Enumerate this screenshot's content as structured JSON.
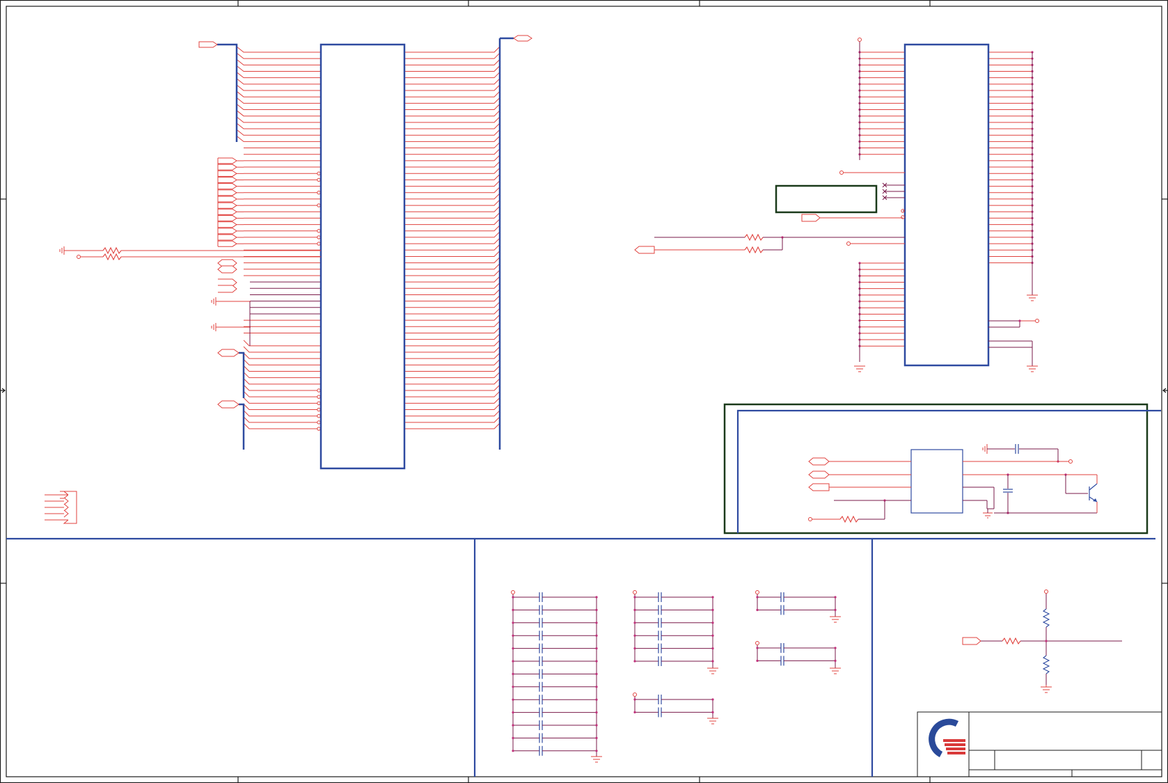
{
  "schematic": {
    "sheet_width": 1678,
    "sheet_height": 1125,
    "colors": {
      "wire": "#e0423e",
      "net": "#7a1a4a",
      "component": "#2e4aa0",
      "frame": "#1a1a1a",
      "highlight_box": "#1a3a1a",
      "junction": "#c0307a",
      "logo_blue": "#2a4a9a",
      "logo_red": "#d93a3a"
    },
    "icons": {
      "logo": "company-logo-icon",
      "ground": "ground-icon",
      "capacitor": "capacitor-icon",
      "resistor": "resistor-icon",
      "transistor": "transistor-icon",
      "port": "net-port-icon"
    }
  }
}
